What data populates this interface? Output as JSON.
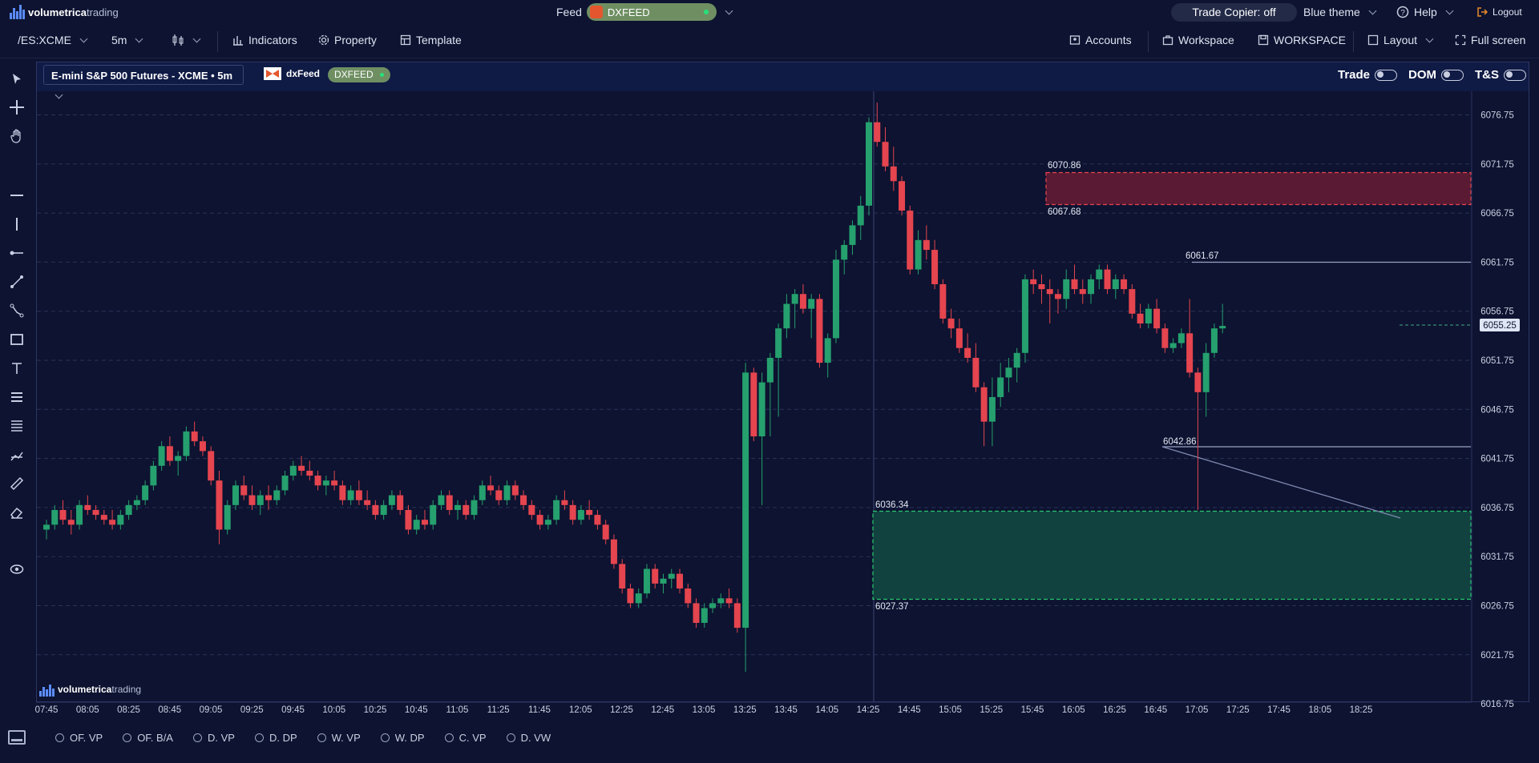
{
  "brand": {
    "name_bold": "volumetrica",
    "name_light": "trading"
  },
  "topbar": {
    "feed_label": "Feed",
    "feed_value": "DXFEED",
    "trade_copier": "Trade Copier: off",
    "theme": "Blue theme",
    "help": "Help",
    "logout": "Logout"
  },
  "toolbar": {
    "symbol": "/ES:XCME",
    "timeframe": "5m",
    "indicators": "Indicators",
    "property": "Property",
    "template": "Template",
    "accounts": "Accounts",
    "workspace": "Workspace",
    "workspace_saved": "WORKSPACE",
    "layout": "Layout",
    "fullscreen": "Full screen"
  },
  "chart_header": {
    "instrument": "E-mini S&P 500 Futures - XCME • 5m",
    "feed_logo": "dxFeed",
    "feed_badge": "DXFEED",
    "trade": "Trade",
    "dom": "DOM",
    "ts": "T&S"
  },
  "sidebar_tools": [
    "cursor-icon",
    "crosshair-icon",
    "hand-icon",
    "horizontal-line-icon",
    "vertical-line-icon",
    "ray-icon",
    "trend-line-icon",
    "path-icon",
    "rectangle-icon",
    "text-icon",
    "fib-icon",
    "channel-icon",
    "pitchfork-icon",
    "ruler-icon",
    "eraser-icon",
    "eye-icon"
  ],
  "bottom_options": [
    "OF. VP",
    "OF. B/A",
    "D. VP",
    "D. DP",
    "W. VP",
    "W. DP",
    "C. VP",
    "D. VW"
  ],
  "colors": {
    "background": "#0d1330",
    "bull": "#25a06e",
    "bear": "#e5454f",
    "zone_supply": "#5a1a34",
    "zone_demand": "#12423f",
    "accent": "#5b8cff"
  },
  "chart_data": {
    "type": "candlestick",
    "y_ticks": [
      "6076.75",
      "6071.75",
      "6066.75",
      "6061.75",
      "6056.75",
      "6051.75",
      "6046.75",
      "6041.75",
      "6036.75",
      "6031.75",
      "6026.75",
      "6021.75",
      "6016.75"
    ],
    "x_ticks": [
      "07:45",
      "08:05",
      "08:25",
      "08:45",
      "09:05",
      "09:25",
      "09:45",
      "10:05",
      "10:25",
      "10:45",
      "11:05",
      "11:25",
      "11:45",
      "12:05",
      "12:25",
      "12:45",
      "13:05",
      "13:25",
      "13:45",
      "14:05",
      "14:25",
      "14:45",
      "15:05",
      "15:25",
      "15:45",
      "16:05",
      "16:25",
      "16:45",
      "17:05",
      "17:25",
      "17:45",
      "18:05",
      "18:25"
    ],
    "last_price": "6055.25",
    "annotations": [
      {
        "label": "6070.86",
        "kind": "supply-zone-top"
      },
      {
        "label": "6067.68",
        "kind": "supply-zone-bottom"
      },
      {
        "label": "6061.67",
        "kind": "resistance-line"
      },
      {
        "label": "6042.86",
        "kind": "support-line"
      },
      {
        "label": "6036.34",
        "kind": "demand-zone-top"
      },
      {
        "label": "6027.37",
        "kind": "demand-zone-bottom"
      }
    ],
    "watermark": "volumetricatrading",
    "candles": [
      [
        6034.5,
        6035.5,
        6033.5,
        6035.0
      ],
      [
        6035.0,
        6037.0,
        6034.5,
        6036.5
      ],
      [
        6036.5,
        6037.5,
        6035.0,
        6035.5
      ],
      [
        6035.5,
        6036.5,
        6034.0,
        6035.0
      ],
      [
        6035.0,
        6037.5,
        6034.5,
        6037.0
      ],
      [
        6037.0,
        6038.0,
        6036.0,
        6036.5
      ],
      [
        6036.5,
        6037.0,
        6035.5,
        6036.0
      ],
      [
        6036.0,
        6036.5,
        6035.0,
        6035.5
      ],
      [
        6035.5,
        6036.5,
        6034.5,
        6035.0
      ],
      [
        6035.0,
        6036.5,
        6034.5,
        6036.0
      ],
      [
        6036.0,
        6037.5,
        6035.5,
        6037.0
      ],
      [
        6037.0,
        6038.0,
        6036.5,
        6037.5
      ],
      [
        6037.5,
        6039.5,
        6037.0,
        6039.0
      ],
      [
        6039.0,
        6041.5,
        6038.5,
        6041.0
      ],
      [
        6041.0,
        6043.5,
        6040.5,
        6043.0
      ],
      [
        6043.0,
        6044.0,
        6041.0,
        6041.5
      ],
      [
        6041.5,
        6042.5,
        6040.0,
        6042.0
      ],
      [
        6042.0,
        6045.0,
        6041.5,
        6044.5
      ],
      [
        6044.5,
        6045.5,
        6043.0,
        6043.5
      ],
      [
        6043.5,
        6044.0,
        6042.0,
        6042.5
      ],
      [
        6042.5,
        6043.0,
        6039.0,
        6039.5
      ],
      [
        6039.5,
        6040.5,
        6033.0,
        6034.5
      ],
      [
        6034.5,
        6037.5,
        6034.0,
        6037.0
      ],
      [
        6037.0,
        6039.5,
        6036.5,
        6039.0
      ],
      [
        6039.0,
        6040.0,
        6037.5,
        6038.0
      ],
      [
        6038.0,
        6039.0,
        6036.5,
        6037.0
      ],
      [
        6037.0,
        6038.5,
        6036.0,
        6038.0
      ],
      [
        6038.0,
        6039.0,
        6036.5,
        6037.5
      ],
      [
        6037.5,
        6039.0,
        6037.0,
        6038.5
      ],
      [
        6038.5,
        6040.5,
        6038.0,
        6040.0
      ],
      [
        6040.0,
        6041.5,
        6039.5,
        6041.0
      ],
      [
        6041.0,
        6042.0,
        6040.0,
        6040.5
      ],
      [
        6040.5,
        6041.5,
        6039.5,
        6040.0
      ],
      [
        6040.0,
        6040.5,
        6038.5,
        6039.0
      ],
      [
        6039.0,
        6040.0,
        6038.0,
        6039.5
      ],
      [
        6039.5,
        6040.5,
        6038.5,
        6039.0
      ],
      [
        6039.0,
        6039.5,
        6037.0,
        6037.5
      ],
      [
        6037.5,
        6039.0,
        6037.0,
        6038.5
      ],
      [
        6038.5,
        6039.5,
        6037.0,
        6037.5
      ],
      [
        6037.5,
        6038.5,
        6036.5,
        6037.0
      ],
      [
        6037.0,
        6037.5,
        6035.5,
        6036.0
      ],
      [
        6036.0,
        6037.5,
        6035.5,
        6037.0
      ],
      [
        6037.0,
        6038.5,
        6036.5,
        6038.0
      ],
      [
        6038.0,
        6038.5,
        6036.0,
        6036.5
      ],
      [
        6036.5,
        6037.0,
        6034.0,
        6034.5
      ],
      [
        6034.5,
        6036.0,
        6034.0,
        6035.5
      ],
      [
        6035.5,
        6036.5,
        6034.5,
        6035.0
      ],
      [
        6035.0,
        6037.5,
        6034.5,
        6037.0
      ],
      [
        6037.0,
        6038.5,
        6036.5,
        6038.0
      ],
      [
        6038.0,
        6038.5,
        6036.0,
        6036.5
      ],
      [
        6036.5,
        6037.5,
        6035.5,
        6037.0
      ],
      [
        6037.0,
        6037.5,
        6035.5,
        6036.0
      ],
      [
        6036.0,
        6038.0,
        6035.5,
        6037.5
      ],
      [
        6037.5,
        6039.5,
        6037.0,
        6039.0
      ],
      [
        6039.0,
        6040.0,
        6038.0,
        6038.5
      ],
      [
        6038.5,
        6039.0,
        6037.0,
        6037.5
      ],
      [
        6037.5,
        6039.5,
        6037.0,
        6039.0
      ],
      [
        6039.0,
        6039.5,
        6037.5,
        6038.0
      ],
      [
        6038.0,
        6038.5,
        6036.5,
        6037.0
      ],
      [
        6037.0,
        6037.5,
        6035.5,
        6036.0
      ],
      [
        6036.0,
        6036.5,
        6034.5,
        6035.0
      ],
      [
        6035.0,
        6036.0,
        6034.5,
        6035.5
      ],
      [
        6035.5,
        6038.0,
        6035.0,
        6037.5
      ],
      [
        6037.5,
        6038.5,
        6036.5,
        6037.0
      ],
      [
        6037.0,
        6037.5,
        6035.0,
        6035.5
      ],
      [
        6035.5,
        6037.0,
        6035.0,
        6036.5
      ],
      [
        6036.5,
        6037.5,
        6035.5,
        6036.0
      ],
      [
        6036.0,
        6036.5,
        6034.5,
        6035.0
      ],
      [
        6035.0,
        6035.5,
        6033.0,
        6033.5
      ],
      [
        6033.5,
        6034.0,
        6030.5,
        6031.0
      ],
      [
        6031.0,
        6031.5,
        6028.0,
        6028.5
      ],
      [
        6028.5,
        6029.0,
        6026.5,
        6027.0
      ],
      [
        6027.0,
        6028.5,
        6026.5,
        6028.0
      ],
      [
        6028.0,
        6031.0,
        6027.5,
        6030.5
      ],
      [
        6030.5,
        6031.0,
        6028.5,
        6029.0
      ],
      [
        6029.0,
        6030.0,
        6028.0,
        6029.5
      ],
      [
        6029.5,
        6030.5,
        6028.5,
        6030.0
      ],
      [
        6030.0,
        6030.5,
        6028.0,
        6028.5
      ],
      [
        6028.5,
        6029.0,
        6026.5,
        6027.0
      ],
      [
        6027.0,
        6027.5,
        6024.5,
        6025.0
      ],
      [
        6025.0,
        6027.0,
        6024.5,
        6026.5
      ],
      [
        6026.5,
        6027.5,
        6026.0,
        6027.0
      ],
      [
        6027.0,
        6028.0,
        6026.5,
        6027.5
      ],
      [
        6027.5,
        6028.5,
        6026.5,
        6027.0
      ],
      [
        6027.0,
        6027.5,
        6024.0,
        6024.5
      ],
      [
        6024.5,
        6051.5,
        6020.0,
        6050.5
      ],
      [
        6050.5,
        6051.0,
        6043.5,
        6044.0
      ],
      [
        6044.0,
        6050.5,
        6037.0,
        6049.5
      ],
      [
        6049.5,
        6052.5,
        6044.0,
        6052.0
      ],
      [
        6052.0,
        6055.5,
        6046.0,
        6055.0
      ],
      [
        6055.0,
        6058.5,
        6054.0,
        6057.5
      ],
      [
        6057.5,
        6059.0,
        6055.0,
        6058.5
      ],
      [
        6058.5,
        6059.5,
        6056.5,
        6057.0
      ],
      [
        6057.0,
        6058.5,
        6054.0,
        6058.0
      ],
      [
        6058.0,
        6058.5,
        6051.0,
        6051.5
      ],
      [
        6051.5,
        6054.5,
        6050.0,
        6054.0
      ],
      [
        6054.0,
        6063.0,
        6053.5,
        6062.0
      ],
      [
        6062.0,
        6064.0,
        6060.5,
        6063.5
      ],
      [
        6063.5,
        6066.0,
        6062.5,
        6065.5
      ],
      [
        6065.5,
        6068.5,
        6064.0,
        6067.5
      ],
      [
        6067.5,
        6076.5,
        6066.5,
        6076.0
      ],
      [
        6076.0,
        6078.0,
        6073.5,
        6074.0
      ],
      [
        6074.0,
        6075.5,
        6071.0,
        6071.5
      ],
      [
        6071.5,
        6073.5,
        6069.0,
        6070.0
      ],
      [
        6070.0,
        6070.5,
        6066.5,
        6067.0
      ],
      [
        6067.0,
        6067.5,
        6060.5,
        6061.0
      ],
      [
        6061.0,
        6065.0,
        6060.5,
        6064.0
      ],
      [
        6064.0,
        6065.5,
        6062.0,
        6063.0
      ],
      [
        6063.0,
        6064.0,
        6059.0,
        6059.5
      ],
      [
        6059.5,
        6060.0,
        6055.5,
        6056.0
      ],
      [
        6056.0,
        6057.0,
        6054.0,
        6055.0
      ],
      [
        6055.0,
        6056.0,
        6052.5,
        6053.0
      ],
      [
        6053.0,
        6054.5,
        6051.5,
        6052.0
      ],
      [
        6052.0,
        6053.5,
        6048.5,
        6049.0
      ],
      [
        6049.0,
        6049.5,
        6043.0,
        6045.5
      ],
      [
        6045.5,
        6050.0,
        6043.0,
        6048.0
      ],
      [
        6048.0,
        6051.5,
        6047.0,
        6050.0
      ],
      [
        6050.0,
        6052.0,
        6048.5,
        6051.0
      ],
      [
        6051.0,
        6053.0,
        6049.5,
        6052.5
      ],
      [
        6052.5,
        6060.5,
        6051.5,
        6060.0
      ],
      [
        6060.0,
        6061.0,
        6058.5,
        6059.5
      ],
      [
        6059.5,
        6060.5,
        6057.5,
        6059.0
      ],
      [
        6059.0,
        6060.0,
        6055.5,
        6058.5
      ],
      [
        6058.5,
        6059.0,
        6056.5,
        6058.0
      ],
      [
        6058.0,
        6061.0,
        6057.0,
        6060.0
      ],
      [
        6060.0,
        6061.5,
        6058.5,
        6059.0
      ],
      [
        6059.0,
        6060.0,
        6057.5,
        6058.5
      ],
      [
        6058.5,
        6060.5,
        6057.5,
        6060.0
      ],
      [
        6060.0,
        6061.5,
        6059.0,
        6061.0
      ],
      [
        6061.0,
        6061.5,
        6058.5,
        6059.0
      ],
      [
        6059.0,
        6060.5,
        6058.0,
        6060.0
      ],
      [
        6060.0,
        6060.5,
        6058.5,
        6059.0
      ],
      [
        6059.0,
        6059.5,
        6056.0,
        6056.5
      ],
      [
        6056.5,
        6057.5,
        6055.0,
        6055.5
      ],
      [
        6055.5,
        6057.5,
        6055.0,
        6057.0
      ],
      [
        6057.0,
        6058.0,
        6054.5,
        6055.0
      ],
      [
        6055.0,
        6055.5,
        6052.5,
        6053.0
      ],
      [
        6053.0,
        6054.0,
        6052.5,
        6053.5
      ],
      [
        6053.5,
        6055.0,
        6053.0,
        6054.5
      ],
      [
        6054.5,
        6058.0,
        6050.0,
        6050.5
      ],
      [
        6050.5,
        6051.0,
        6036.5,
        6048.5
      ],
      [
        6048.5,
        6053.5,
        6046.0,
        6052.5
      ],
      [
        6052.5,
        6055.5,
        6052.0,
        6055.0
      ],
      [
        6055.0,
        6057.5,
        6054.5,
        6055.25
      ]
    ]
  }
}
